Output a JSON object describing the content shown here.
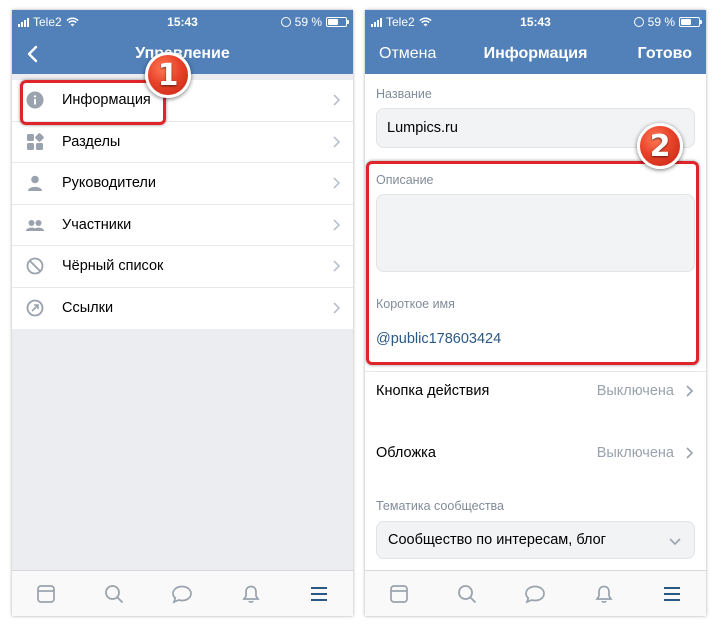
{
  "colors": {
    "header": "#5181b8",
    "accent_link": "#2a5885",
    "tab_active": "#2a5885",
    "tab_inactive": "#99a2ad",
    "highlight": "#e0242b",
    "badge": "#e8432a"
  },
  "status_bar": {
    "carrier": "Tele2",
    "time": "15:43",
    "battery": "59 %",
    "battery_level": 0.59
  },
  "left_screen": {
    "nav_title": "Управление",
    "menu": [
      {
        "label": "Информация",
        "icon": "info-icon"
      },
      {
        "label": "Разделы",
        "icon": "sections-icon"
      },
      {
        "label": "Руководители",
        "icon": "person-icon"
      },
      {
        "label": "Участники",
        "icon": "people-icon"
      },
      {
        "label": "Чёрный список",
        "icon": "block-icon"
      },
      {
        "label": "Ссылки",
        "icon": "link-icon"
      }
    ],
    "badge_number": "1"
  },
  "right_screen": {
    "nav_cancel": "Отмена",
    "nav_title": "Информация",
    "nav_done": "Готово",
    "name_label": "Название",
    "name_value": "Lumpics.ru",
    "description_label": "Описание",
    "description_value": "",
    "short_name_label": "Короткое имя",
    "short_name_value": "@public178603424",
    "action_button_label": "Кнопка действия",
    "action_button_value": "Выключена",
    "cover_label": "Обложка",
    "cover_value": "Выключена",
    "topic_label": "Тематика сообщества",
    "topic_value": "Сообщество по интересам, блог",
    "badge_number": "2"
  },
  "tabbar": {
    "tabs": [
      "news-icon",
      "search-icon",
      "messages-icon",
      "notifications-icon",
      "menu-icon"
    ],
    "active_index": 4
  }
}
